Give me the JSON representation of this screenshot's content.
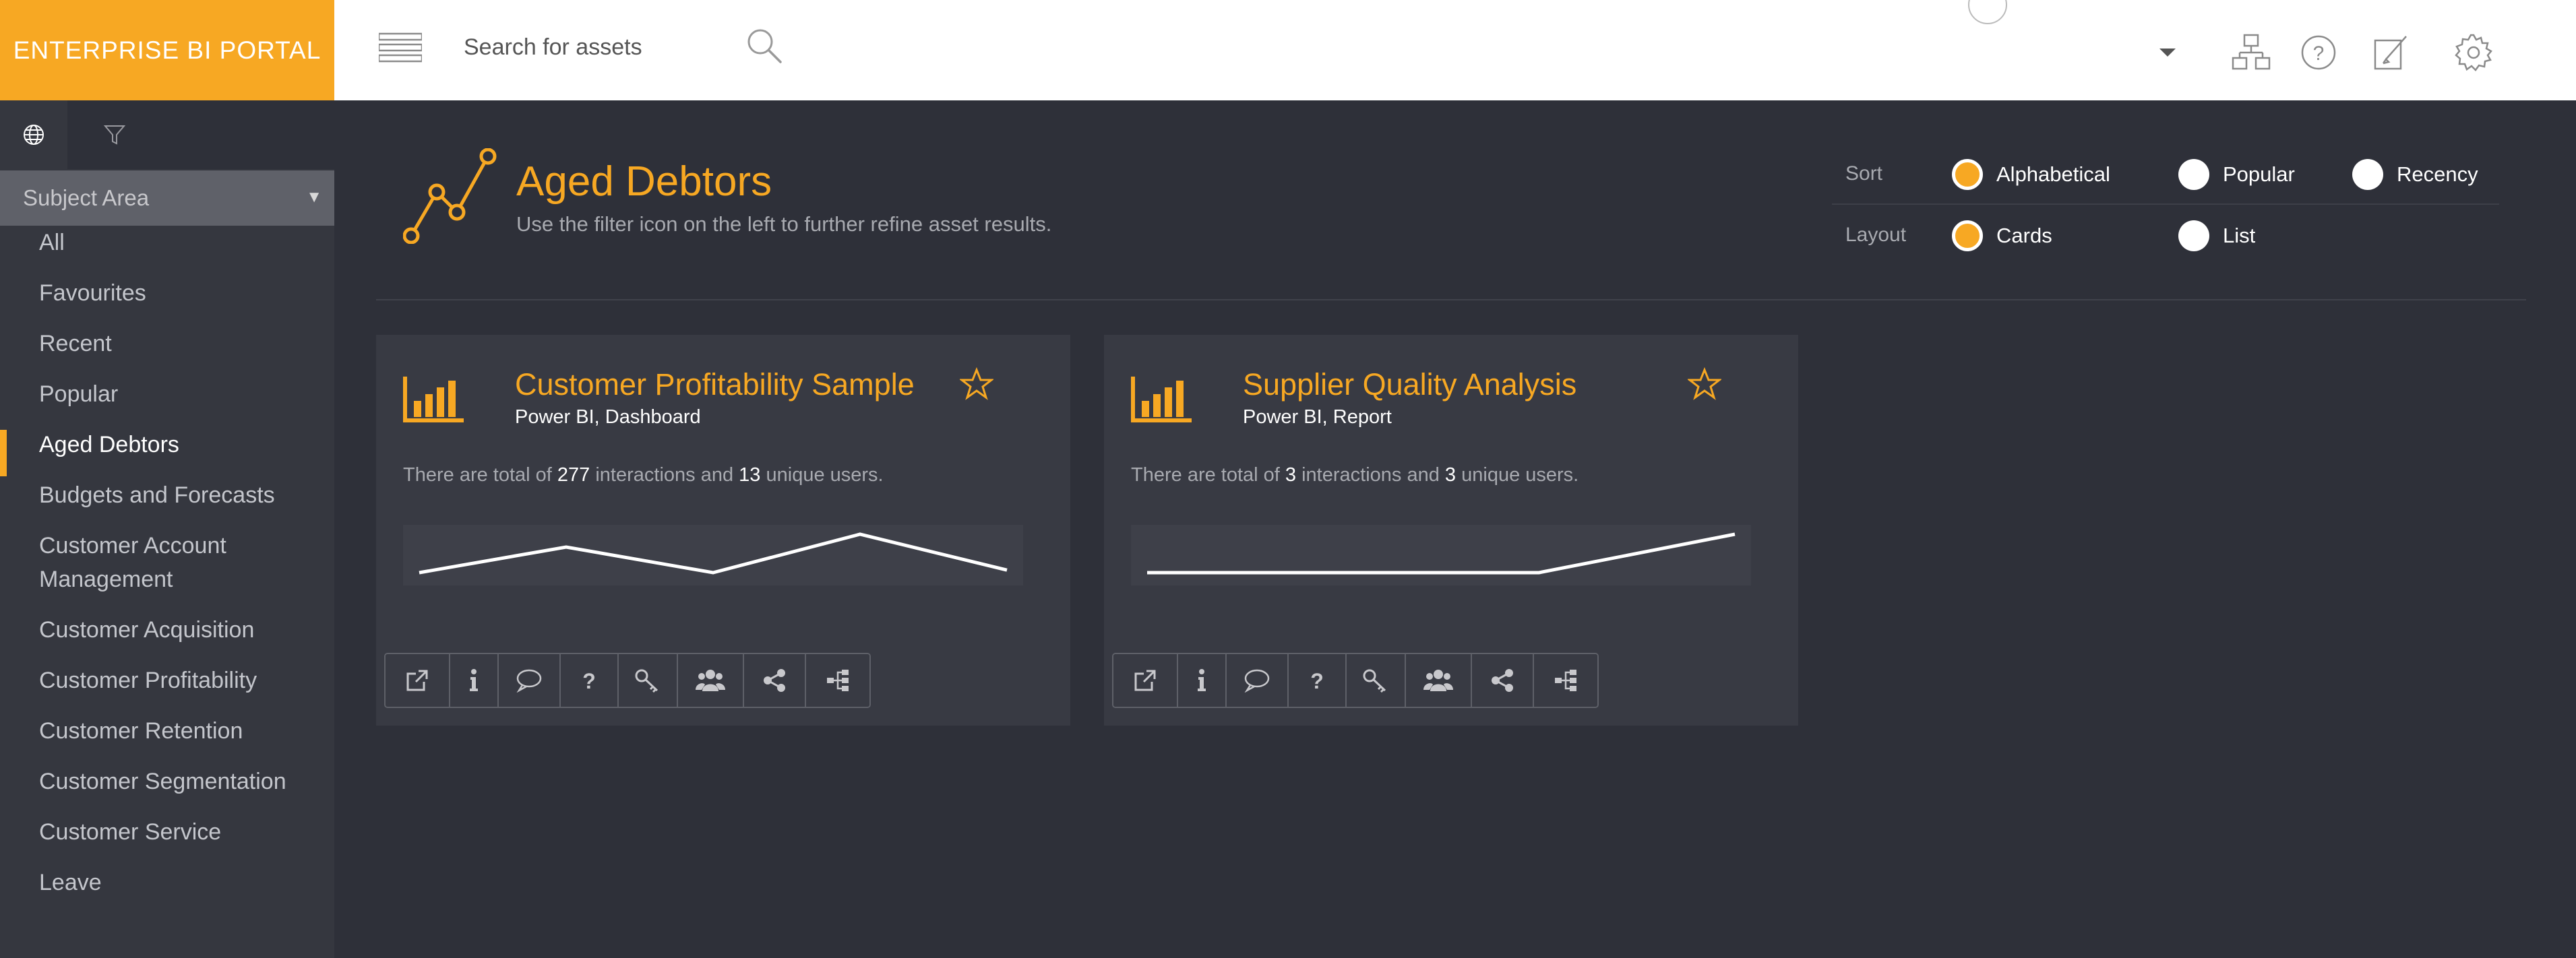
{
  "header": {
    "brand": "ENTERPRISE BI PORTAL",
    "search_placeholder": "Search for assets",
    "icons": [
      "menu-icon",
      "search-icon",
      "user-avatar",
      "chevron-down-icon",
      "hierarchy-icon",
      "help-icon",
      "edit-icon",
      "gear-icon"
    ]
  },
  "sidebar": {
    "tabs": [
      "globe-icon",
      "filter-icon"
    ],
    "subject_area": "Subject Area",
    "items": [
      {
        "label": "All"
      },
      {
        "label": "Favourites"
      },
      {
        "label": "Recent"
      },
      {
        "label": "Popular"
      },
      {
        "label": "Aged Debtors",
        "active": true
      },
      {
        "label": "Budgets and Forecasts"
      },
      {
        "label": "Customer Account Management"
      },
      {
        "label": "Customer Acquisition"
      },
      {
        "label": "Customer Profitability"
      },
      {
        "label": "Customer Retention"
      },
      {
        "label": "Customer Segmentation"
      },
      {
        "label": "Customer Service"
      },
      {
        "label": "Leave"
      }
    ]
  },
  "main": {
    "title": "Aged Debtors",
    "subtitle": "Use the filter icon on the left to further refine asset results.",
    "sort": {
      "label": "Sort",
      "options": [
        "Alphabetical",
        "Popular",
        "Recency"
      ],
      "selected": "Alphabetical"
    },
    "layout": {
      "label": "Layout",
      "options": [
        "Cards",
        "List"
      ],
      "selected": "Cards"
    },
    "cards": [
      {
        "title": "Customer Profitability Sample",
        "subtitle": "Power BI, Dashboard",
        "stats_prefix": "There are total of",
        "interactions": "277",
        "stats_middle": "interactions and",
        "users": "13",
        "stats_suffix": "unique users.",
        "trend": [
          10,
          30,
          10,
          40,
          12
        ]
      },
      {
        "title": "Supplier Quality Analysis",
        "subtitle": "Power BI, Report",
        "stats_prefix": "There are total of",
        "interactions": "3",
        "stats_middle": "interactions and",
        "users": "3",
        "stats_suffix": "unique users.",
        "trend": [
          10,
          10,
          10,
          40
        ]
      }
    ],
    "card_actions": [
      "open-external-icon",
      "info-icon",
      "comment-icon",
      "question-icon",
      "key-icon",
      "users-icon",
      "share-icon",
      "lineage-icon"
    ]
  },
  "colors": {
    "accent": "#f7a823",
    "background": "#2e3039",
    "sidebar": "#35373f",
    "card": "#383a43"
  }
}
